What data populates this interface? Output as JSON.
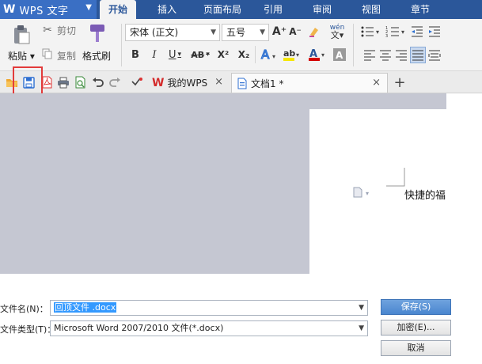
{
  "app": {
    "logo": "W",
    "title": "WPS 文字",
    "menu_arrow": "▼"
  },
  "tabs": [
    {
      "label": "开始",
      "active": true
    },
    {
      "label": "插入"
    },
    {
      "label": "页面布局"
    },
    {
      "label": "引用"
    },
    {
      "label": "审阅"
    },
    {
      "label": "视图"
    },
    {
      "label": "章节"
    }
  ],
  "ribbon": {
    "paste_label": "粘贴",
    "cut_label": "剪切",
    "copy_label": "复制",
    "format_painter_label": "格式刷",
    "font_name": "宋体 (正文)",
    "font_size": "五号",
    "wen_label": "wén",
    "bold": "B",
    "italic": "I",
    "underline": "U",
    "strikethrough": "AB",
    "superscript": "X²",
    "subscript": "X₂",
    "grow_font": "A⁺",
    "shrink_font": "A⁻",
    "colors": {
      "highlight": "#f5e600",
      "font_color": "#d40000",
      "accent": "#2b579a"
    }
  },
  "doc_tabs": [
    {
      "label": "我的WPS"
    },
    {
      "label": "文档1 *",
      "active": true
    }
  ],
  "new_tab_symbol": "+",
  "close_symbol": "×",
  "document": {
    "visible_text": "快捷的福"
  },
  "dialog": {
    "filename_label": "文件名(N)：",
    "filename_value": "回顶文件 .docx",
    "filetype_label": "文件类型(T)：",
    "filetype_value": "Microsoft Word 2007/2010 文件(*.docx)",
    "save_button": "保存(S)",
    "encrypt_button": "加密(E)...",
    "cancel_button": "取消"
  }
}
